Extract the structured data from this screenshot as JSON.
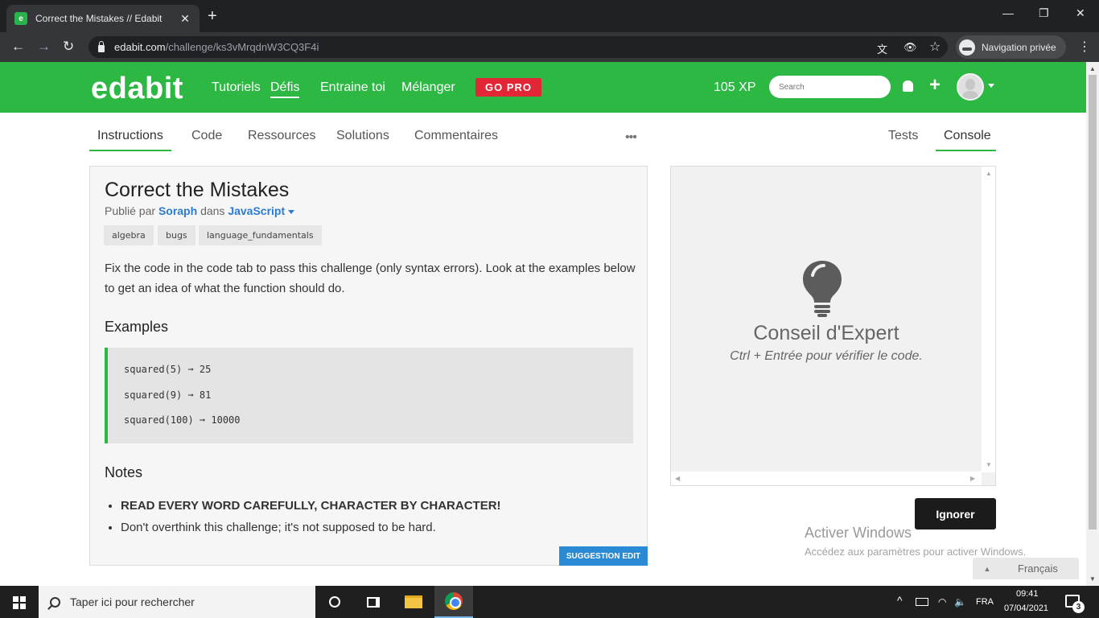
{
  "browser": {
    "tab_title": "Correct the Mistakes // Edabit",
    "tab_close": "✕",
    "new_tab": "+",
    "url_host": "edabit.com",
    "url_path": "/challenge/ks3vMrqdnW3CQ3F4i",
    "incognito_label": "Navigation privée",
    "win_minimize": "—",
    "win_restore": "❐",
    "win_close": "✕",
    "back": "←",
    "forward": "→",
    "reload": "↻",
    "kebab": "⋮",
    "translate_icon": "⽂",
    "eye_off_icon": "👁",
    "star_icon": "☆"
  },
  "site": {
    "logo": "edabit",
    "nav": [
      "Tutoriels",
      "Défis",
      "Entraine toi",
      "Mélanger"
    ],
    "go_pro": "GO PRO",
    "xp": "105 XP",
    "search_placeholder": "Search",
    "plus": "+"
  },
  "tabs": {
    "left": [
      "Instructions",
      "Code",
      "Ressources",
      "Solutions",
      "Commentaires"
    ],
    "more": "•••",
    "right": [
      "Tests",
      "Console"
    ]
  },
  "challenge": {
    "title": "Correct the Mistakes",
    "published_by": "Publié par",
    "author": "Soraph",
    "in_word": "dans",
    "language": "JavaScript",
    "tags": [
      "algebra",
      "bugs",
      "language_fundamentals"
    ],
    "description": "Fix the code in the code tab to pass this challenge (only syntax errors). Look at the examples below to get an idea of what the function should do.",
    "examples_heading": "Examples",
    "examples": [
      "squared(5) ➞ 25",
      "squared(9) ➞ 81",
      "squared(100) ➞ 10000"
    ],
    "notes_heading": "Notes",
    "notes": [
      "READ EVERY WORD CAREFULLY, CHARACTER BY CHARACTER!",
      "Don't overthink this challenge; it's not supposed to be hard."
    ],
    "suggestion_edit": "SUGGESTION EDIT"
  },
  "console": {
    "tip_title": "Conseil d'Expert",
    "tip_sub": "Ctrl + Entrée pour vérifier le code.",
    "ignore": "Ignorer"
  },
  "watermark": {
    "title": "Activer Windows",
    "sub": "Accédez aux paramètres pour activer Windows."
  },
  "language_bar": {
    "label": "Français",
    "arrow": "▲"
  },
  "taskbar": {
    "search_placeholder": "Taper ici pour rechercher",
    "lang": "FRA",
    "time": "09:41",
    "date": "07/04/2021",
    "notifications": "3",
    "tray_chevron": "^",
    "wifi_icon": "◠",
    "speaker_icon": "🔈"
  },
  "colors": {
    "brand_green": "#2cb843",
    "go_pro_red": "#e32636",
    "link_blue": "#2b7bd0",
    "suggest_blue": "#2b8ad4"
  }
}
